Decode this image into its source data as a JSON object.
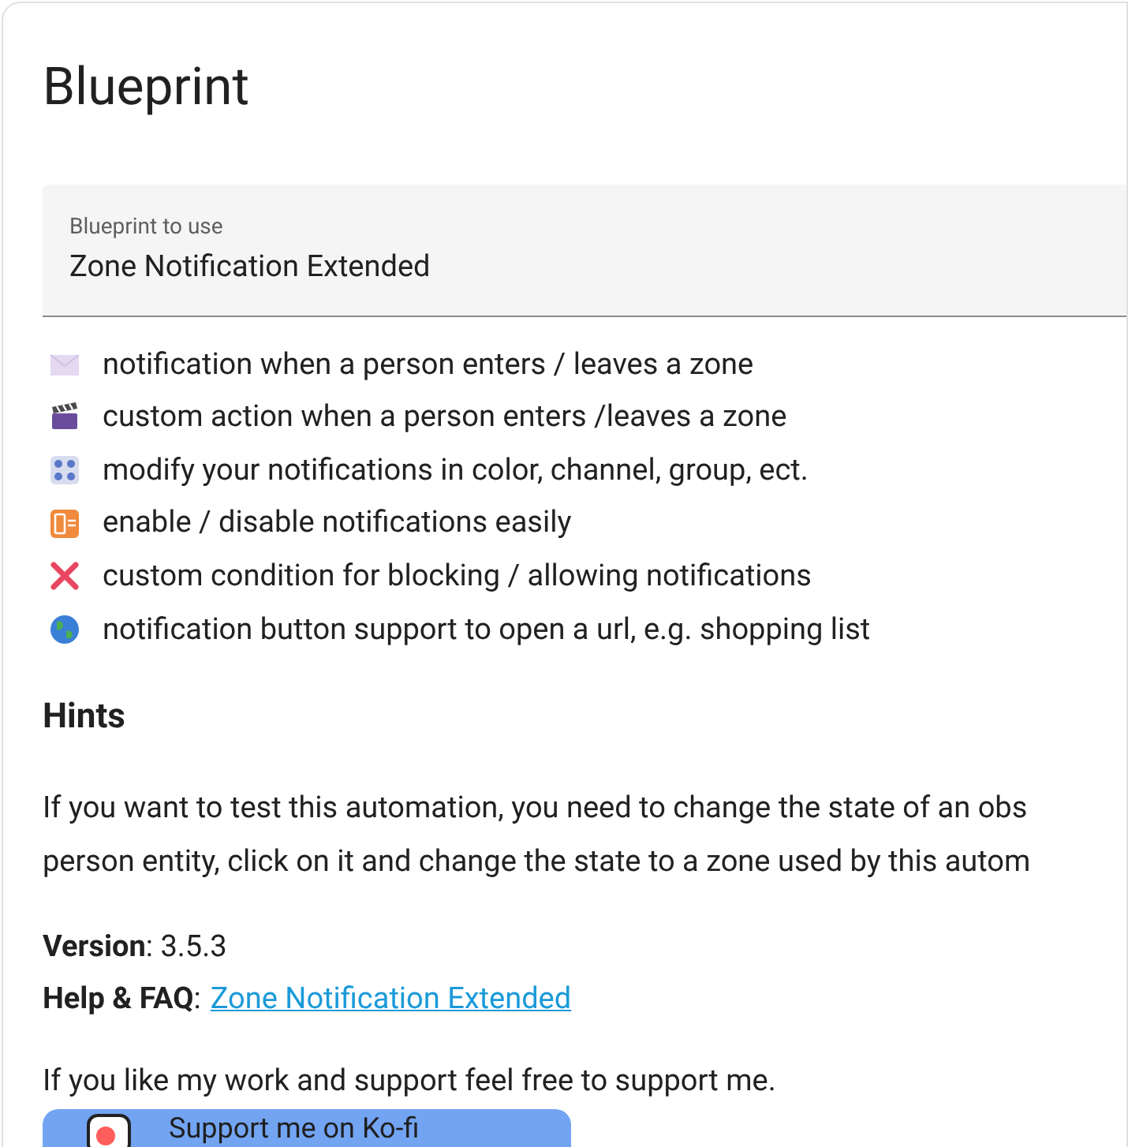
{
  "card": {
    "title": "Blueprint"
  },
  "blueprint_field": {
    "label": "Blueprint to use",
    "value": "Zone Notification Extended"
  },
  "features": [
    {
      "kind": "envelope",
      "text": "notification when a person enters / leaves a zone"
    },
    {
      "kind": "clapper",
      "text": "custom action when a person enters /leaves a zone"
    },
    {
      "kind": "controls",
      "text": "modify your notifications in color, channel, group, ect."
    },
    {
      "kind": "phone_off",
      "text": "enable / disable notifications easily"
    },
    {
      "kind": "cross",
      "text": "custom condition for blocking / allowing notifications"
    },
    {
      "kind": "globe",
      "text": "notification button support to open a url, e.g. shopping list"
    }
  ],
  "hints": {
    "heading": "Hints",
    "lines": [
      "If you want to test this automation, you need to change the state of an obs",
      "person entity, click on it and change the state to a zone used by this autom"
    ]
  },
  "version": {
    "text": "**Version**: 3.5.3"
  },
  "help": {
    "label": "**Help & FAQ**:",
    "link": "Zone Notification Extended"
  },
  "support": {
    "text": "If you like my work and support feel free to support me.",
    "button": "Support me on Ko-fi"
  }
}
